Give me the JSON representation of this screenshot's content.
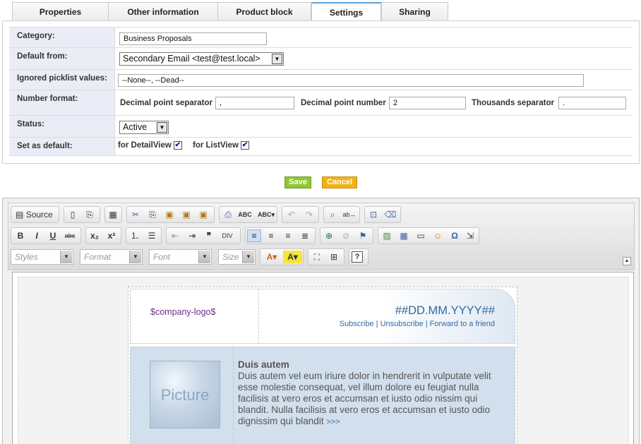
{
  "tabs": [
    {
      "label": "Properties"
    },
    {
      "label": "Other information"
    },
    {
      "label": "Product block"
    },
    {
      "label": "Settings"
    },
    {
      "label": "Sharing"
    }
  ],
  "form": {
    "category": {
      "label": "Category:",
      "value": "Business Proposals"
    },
    "default_from": {
      "label": "Default from:",
      "value": "Secondary Email <test@test.local>"
    },
    "ignored": {
      "label": "Ignored picklist values:",
      "value": "--None--, --Dead--"
    },
    "number_format": {
      "label": "Number format:",
      "decimal_sep_label": "Decimal point separator",
      "decimal_sep_value": ",",
      "decimal_num_label": "Decimal point number",
      "decimal_num_value": "2",
      "thousands_label": "Thousands separator",
      "thousands_value": "."
    },
    "status": {
      "label": "Status:",
      "value": "Active"
    },
    "set_default": {
      "label": "Set as default:",
      "detail_label": "for DetailView",
      "list_label": "for ListView",
      "detail_checked": true,
      "list_checked": true
    }
  },
  "buttons": {
    "save": "Save",
    "cancel": "Cancel"
  },
  "editor": {
    "source_label": "Source",
    "combos": {
      "styles": "Styles",
      "format": "Format",
      "font": "Font",
      "size": "Size"
    }
  },
  "template": {
    "logo": "$company-logo$",
    "date": "##DD.MM.YYYY##",
    "links": "Subscribe | Unsubscribe | Forward to a friend",
    "picture": "Picture",
    "title": "Duis autem",
    "body": "Duis autem vel eum iriure dolor in hendrerit in vulputate velit esse molestie consequat, vel illum dolore eu feugiat nulla facilisis at vero eros et accumsan et iusto odio nissim qui blandit. Nulla facilisis at vero eros et accumsan et iusto odio dignissim qui blandit",
    "more": ">>>"
  },
  "colors": {
    "save_btn": "#8fc832",
    "cancel_btn": "#f3b21a",
    "tab_active": "#5aa0dc",
    "label_bg": "#ebedf6",
    "date_color": "#2f6a9f"
  }
}
